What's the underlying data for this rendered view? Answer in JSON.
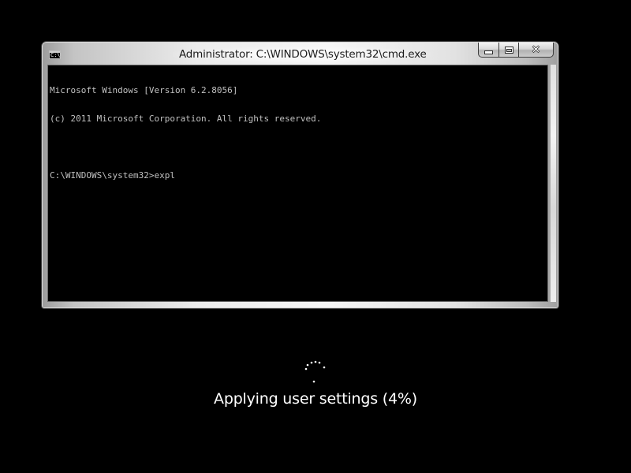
{
  "window": {
    "title": "Administrator: C:\\WINDOWS\\system32\\cmd.exe",
    "icon": "cmd-prompt-icon",
    "icon_text": "C:\\",
    "buttons": {
      "minimize": "minimize-icon",
      "maximize": "maximize-icon",
      "close": "close-icon",
      "close_glyph": "✕"
    }
  },
  "console": {
    "line1": "Microsoft Windows [Version 6.2.8056]",
    "line2": "(c) 2011 Microsoft Corporation. All rights reserved.",
    "prompt_line": "C:\\WINDOWS\\system32>expl"
  },
  "status": {
    "message": "Applying user settings (4%)",
    "progress_percent": 4
  },
  "colors": {
    "background": "#000000",
    "console_text": "#c0c0c0",
    "status_text": "#ffffff"
  }
}
